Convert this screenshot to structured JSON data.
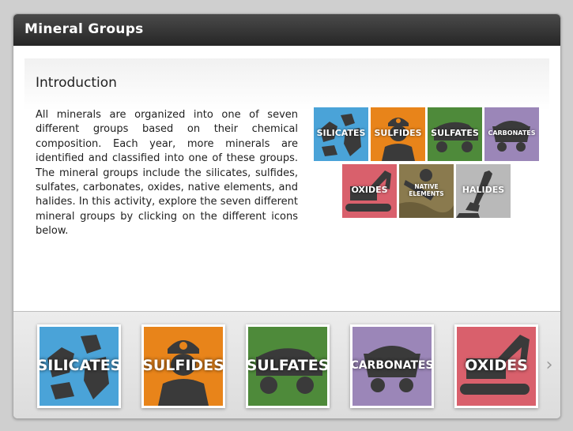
{
  "window": {
    "title": "Mineral Groups"
  },
  "intro": {
    "heading": "Introduction",
    "body": "All minerals are organized into one of seven different groups based on their chemical composition. Each year, more minerals are identified and classified into one of these groups. The mineral groups include the silicates, sulfides, sulfates, carbonates, oxides, native elements, and halides. In this activity, explore the seven different mineral groups by clicking on the different icons below."
  },
  "overview": {
    "tiles": [
      {
        "label": "SILICATES",
        "color": "#4aa3d8",
        "icon": "rocks-icon"
      },
      {
        "label": "SULFIDES",
        "color": "#e8841a",
        "icon": "miner-icon"
      },
      {
        "label": "SULFATES",
        "color": "#4e8a3a",
        "icon": "mine-truck-icon"
      },
      {
        "label": "CARBONATES",
        "color": "#9b86b8",
        "icon": "mine-cart-icon"
      },
      {
        "label": "OXIDES",
        "color": "#d9606c",
        "icon": "excavator-icon"
      },
      {
        "label": "NATIVE ELEMENTS",
        "color": "#8a7a4e",
        "icon": "gold-pan-icon"
      },
      {
        "label": "HALIDES",
        "color": "#b9b9b9",
        "icon": "pickaxe-icon"
      }
    ]
  },
  "nav": {
    "items": [
      {
        "label": "SILICATES",
        "color": "#4aa3d8",
        "icon": "rocks-icon"
      },
      {
        "label": "SULFIDES",
        "color": "#e8841a",
        "icon": "miner-icon"
      },
      {
        "label": "SULFATES",
        "color": "#4e8a3a",
        "icon": "mine-truck-icon"
      },
      {
        "label": "CARBONATES",
        "color": "#9b86b8",
        "icon": "mine-cart-icon"
      },
      {
        "label": "OXIDES",
        "color": "#d9606c",
        "icon": "excavator-icon"
      }
    ],
    "next_icon": "chevron-right-icon",
    "next_glyph": "›"
  }
}
